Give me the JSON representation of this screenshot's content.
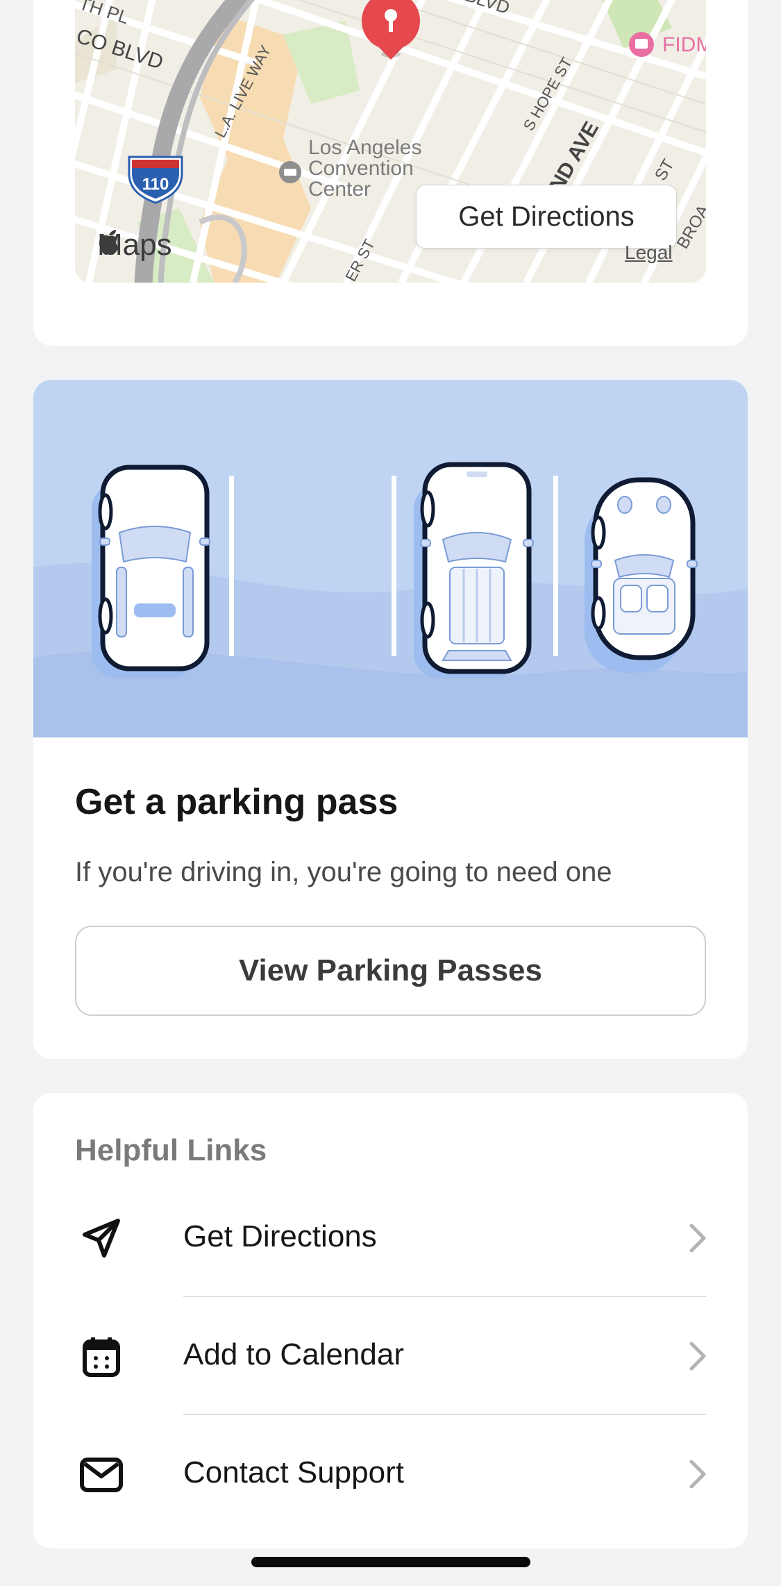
{
  "map": {
    "labels": {
      "street_th_pl": "TH PL",
      "street_pico": "CO BLVD",
      "street_blvd_top": "BLVD",
      "street_la_live": "L.A. LIVE WAY",
      "street_hope": "S HOPE ST",
      "street_grand": "ND AVE",
      "street_hill": "LL ST",
      "street_broadway": "BROA",
      "street_figueroa": "ER ST",
      "street_st": "ST",
      "venue_line1": "Los Angeles",
      "venue_line2": "Convention",
      "venue_line3": "Center",
      "poi": "FIDM",
      "highway": "110"
    },
    "get_directions_label": "Get Directions",
    "maps_logo_text": "Maps",
    "legal_text": "Legal"
  },
  "parking": {
    "title": "Get a parking pass",
    "subtitle": "If you're driving in, you're going to need one",
    "button_label": "View Parking Passes"
  },
  "helpful_links": {
    "title": "Helpful Links",
    "items": [
      {
        "label": "Get Directions",
        "icon": "location-arrow-icon"
      },
      {
        "label": "Add to Calendar",
        "icon": "calendar-icon"
      },
      {
        "label": "Contact Support",
        "icon": "mail-icon"
      }
    ]
  },
  "colors": {
    "page_bg": "#f3f3f5",
    "card_bg": "#ffffff",
    "parking_bg": "#bfd4f2",
    "pin": "#e5484d",
    "highway_shield": "#2a5fb0"
  }
}
